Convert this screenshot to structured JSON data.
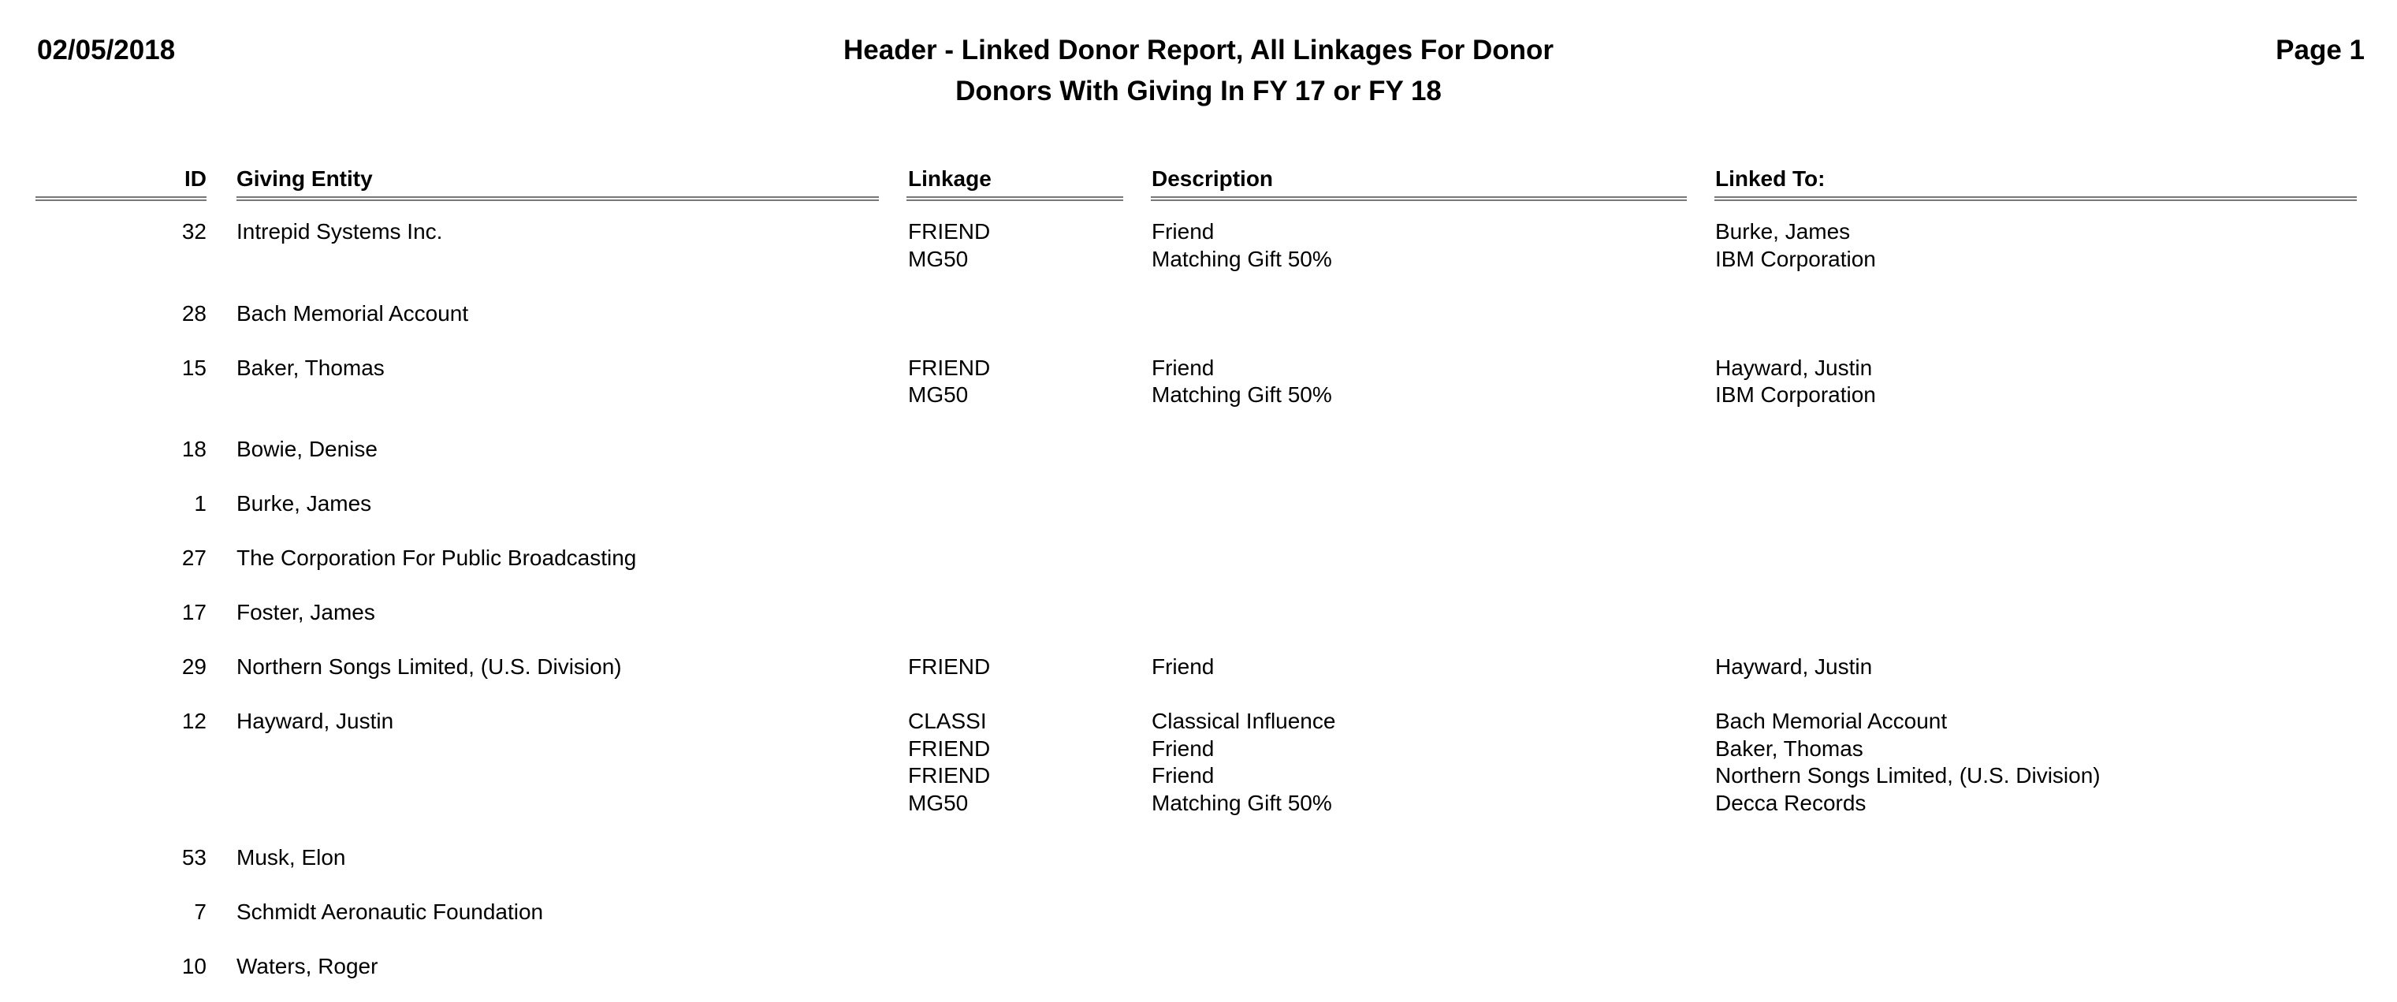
{
  "header": {
    "date": "02/05/2018",
    "title": "Header - Linked Donor Report, All Linkages For Donor",
    "subtitle": "Donors With Giving In FY 17 or FY 18",
    "page": "Page 1"
  },
  "columns": {
    "id": "ID",
    "giving_entity": "Giving Entity",
    "linkage": "Linkage",
    "description": "Description",
    "linked_to": "Linked To:"
  },
  "rows": [
    {
      "id": "32",
      "entity": "Intrepid Systems Inc.",
      "links": [
        {
          "linkage": "FRIEND",
          "description": "Friend",
          "linked_to": "Burke, James"
        },
        {
          "linkage": "MG50",
          "description": "Matching Gift 50%",
          "linked_to": "IBM Corporation"
        }
      ]
    },
    {
      "id": "28",
      "entity": "Bach Memorial Account",
      "links": []
    },
    {
      "id": "15",
      "entity": "Baker, Thomas",
      "links": [
        {
          "linkage": "FRIEND",
          "description": "Friend",
          "linked_to": "Hayward, Justin"
        },
        {
          "linkage": "MG50",
          "description": "Matching Gift 50%",
          "linked_to": "IBM Corporation"
        }
      ]
    },
    {
      "id": "18",
      "entity": "Bowie, Denise",
      "links": []
    },
    {
      "id": "1",
      "entity": "Burke, James",
      "links": []
    },
    {
      "id": "27",
      "entity": "The Corporation For Public Broadcasting",
      "links": []
    },
    {
      "id": "17",
      "entity": "Foster, James",
      "links": []
    },
    {
      "id": "29",
      "entity": "Northern Songs Limited, (U.S. Division)",
      "links": [
        {
          "linkage": "FRIEND",
          "description": "Friend",
          "linked_to": "Hayward, Justin"
        }
      ]
    },
    {
      "id": "12",
      "entity": "Hayward, Justin",
      "links": [
        {
          "linkage": "CLASSI",
          "description": "Classical Influence",
          "linked_to": "Bach Memorial Account"
        },
        {
          "linkage": "FRIEND",
          "description": "Friend",
          "linked_to": "Baker, Thomas"
        },
        {
          "linkage": "FRIEND",
          "description": "Friend",
          "linked_to": "Northern Songs Limited, (U.S. Division)"
        },
        {
          "linkage": "MG50",
          "description": "Matching Gift 50%",
          "linked_to": "Decca Records"
        }
      ]
    },
    {
      "id": "53",
      "entity": "Musk, Elon",
      "links": []
    },
    {
      "id": "7",
      "entity": "Schmidt Aeronautic Foundation",
      "links": []
    },
    {
      "id": "10",
      "entity": "Waters, Roger",
      "links": []
    }
  ]
}
